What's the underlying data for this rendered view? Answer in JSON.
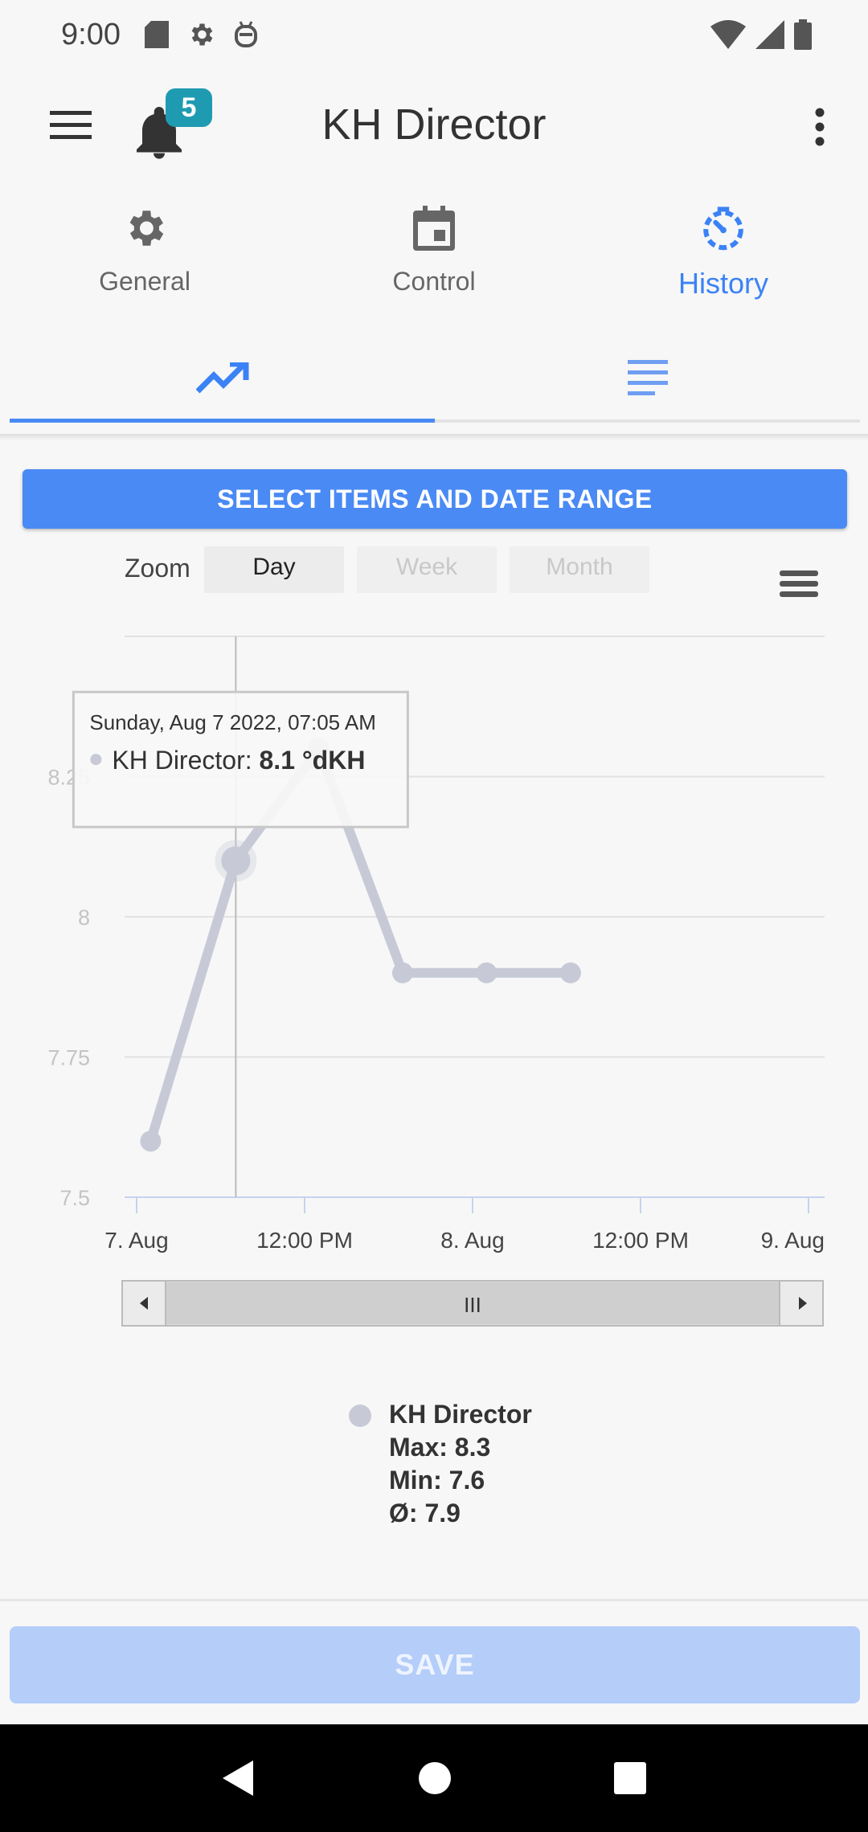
{
  "status_bar": {
    "time": "9:00",
    "left_icons": [
      "sd-card-icon",
      "settings-icon",
      "android-debug-icon"
    ],
    "right_icons": [
      "wifi-icon",
      "signal-icon",
      "battery-icon"
    ]
  },
  "app_bar": {
    "title": "KH Director",
    "notification_count": "5"
  },
  "main_tabs": [
    {
      "label": "General",
      "icon": "gear-icon"
    },
    {
      "label": "Control",
      "icon": "calendar-icon"
    },
    {
      "label": "History",
      "icon": "history-icon",
      "active": true
    }
  ],
  "sub_tabs": [
    {
      "icon": "trending-up-icon",
      "active": true
    },
    {
      "icon": "list-icon",
      "active": false
    }
  ],
  "select_button": "SELECT ITEMS AND DATE RANGE",
  "zoom": {
    "label": "Zoom",
    "options": [
      "Day",
      "Week",
      "Month"
    ],
    "selected": "Day"
  },
  "chart_data": {
    "type": "line",
    "series": [
      {
        "name": "KH Director",
        "color": "#c7cad6",
        "points": [
          {
            "t": "2022-08-07 01:00",
            "y": 7.6
          },
          {
            "t": "2022-08-07 07:05",
            "y": 8.1
          },
          {
            "t": "2022-08-07 13:00",
            "y": 8.3
          },
          {
            "t": "2022-08-07 19:00",
            "y": 7.9
          },
          {
            "t": "2022-08-08 01:00",
            "y": 7.9
          },
          {
            "t": "2022-08-08 07:00",
            "y": 7.9
          }
        ]
      }
    ],
    "y_ticks": [
      "7.5",
      "7.75",
      "8",
      "8.25"
    ],
    "x_tick_labels": [
      "7. Aug",
      "12:00 PM",
      "8. Aug",
      "12:00 PM",
      "9. Aug"
    ],
    "ylim": [
      7.5,
      8.5
    ],
    "xlim": [
      "2022-08-07 00:00",
      "2022-08-09 00:00"
    ],
    "grid": true,
    "tooltip": {
      "header": "Sunday, Aug 7 2022, 07:05 AM",
      "series_label": "KH Director: ",
      "value_label": "8.1 °dKH"
    },
    "navigator": {
      "grip": "III"
    }
  },
  "legend": {
    "name": "KH Director",
    "max": "Max: 8.3",
    "min": "Min: 7.6",
    "avg": "Ø: 7.9"
  },
  "save_button": "SAVE",
  "colors": {
    "accent": "#4a8af4",
    "badge": "#1f9bb1",
    "series": "#c7cad6"
  }
}
